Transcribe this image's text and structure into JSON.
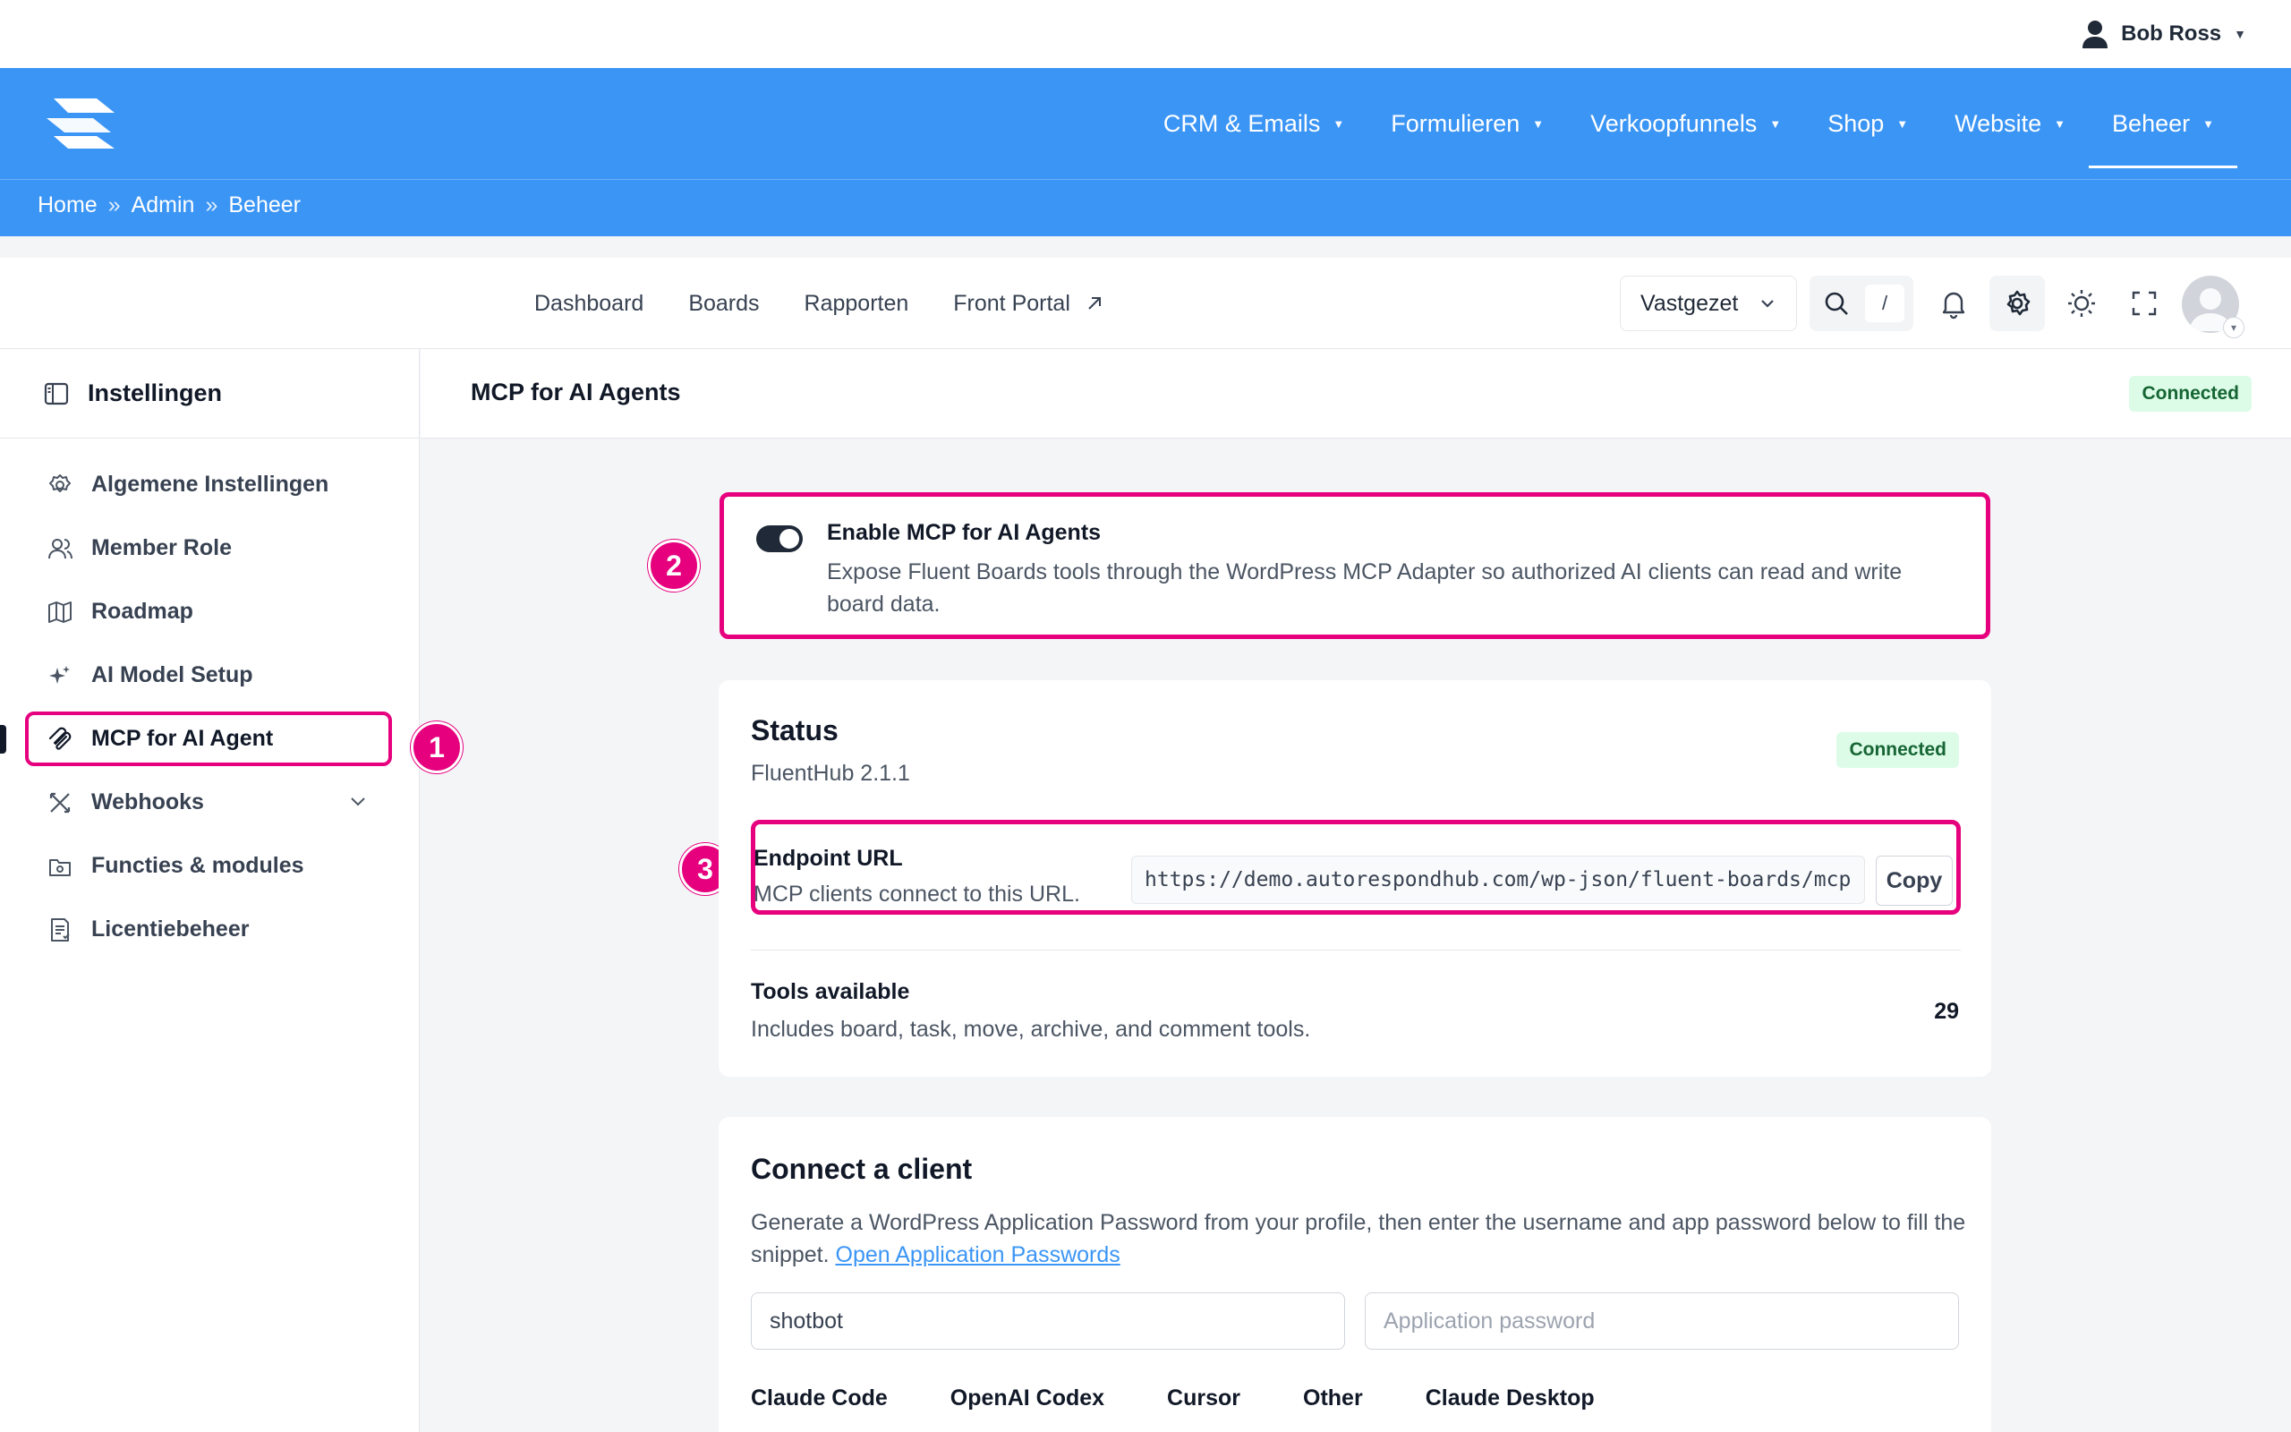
{
  "adminbar": {
    "user_name": "Bob Ross"
  },
  "header": {
    "nav": [
      {
        "label": "CRM & Emails"
      },
      {
        "label": "Formulieren"
      },
      {
        "label": "Verkoopfunnels"
      },
      {
        "label": "Shop"
      },
      {
        "label": "Website"
      },
      {
        "label": "Beheer",
        "active": true
      }
    ],
    "breadcrumb": [
      "Home",
      "Admin",
      "Beheer"
    ],
    "breadcrumb_sep": "»"
  },
  "subnav": {
    "tabs": [
      {
        "label": "Dashboard"
      },
      {
        "label": "Boards"
      },
      {
        "label": "Rapporten"
      },
      {
        "label": "Front Portal"
      }
    ],
    "pinned_label": "Vastgezet",
    "search_shortcut": "/"
  },
  "sidebar": {
    "title": "Instellingen",
    "items": [
      {
        "label": "Algemene Instellingen",
        "icon": "gear-icon"
      },
      {
        "label": "Member Role",
        "icon": "users-icon"
      },
      {
        "label": "Roadmap",
        "icon": "map-icon"
      },
      {
        "label": "AI Model Setup",
        "icon": "sparkle-icon"
      },
      {
        "label": "MCP for AI Agent",
        "icon": "mcp-icon",
        "active": true
      },
      {
        "label": "Webhooks",
        "icon": "webhook-icon",
        "expandable": true
      },
      {
        "label": "Functies & modules",
        "icon": "modules-icon"
      },
      {
        "label": "Licentiebeheer",
        "icon": "license-icon"
      }
    ]
  },
  "main": {
    "title": "MCP for AI Agents",
    "status_badge": "Connected",
    "toggle": {
      "title": "Enable MCP for AI Agents",
      "description": "Expose Fluent Boards tools through the WordPress MCP Adapter so authorized AI clients can read and write board data.",
      "enabled": true
    },
    "status": {
      "title": "Status",
      "version": "FluentHub 2.1.1",
      "badge": "Connected",
      "endpoint_label": "Endpoint URL",
      "endpoint_help": "MCP clients connect to this URL.",
      "endpoint_url": "https://demo.autorespondhub.com/wp-json/fluent-boards/mcp",
      "copy_label": "Copy",
      "tools_title": "Tools available",
      "tools_desc": "Includes board, task, move, archive, and comment tools.",
      "tools_count": "29"
    },
    "connect": {
      "title": "Connect a client",
      "desc": "Generate a WordPress Application Password from your profile, then enter the username and app password below to fill the snippet.",
      "link": "Open Application Passwords",
      "username_value": "shotbot",
      "password_placeholder": "Application password",
      "clients": [
        "Claude Code",
        "OpenAI Codex",
        "Cursor",
        "Other",
        "Claude Desktop"
      ]
    }
  },
  "annotations": [
    "1",
    "2",
    "3"
  ],
  "colors": {
    "brand_blue": "#3b95f5",
    "highlight_pink": "#e6007e",
    "success_bg": "#dcfce7",
    "success_text": "#166534"
  }
}
